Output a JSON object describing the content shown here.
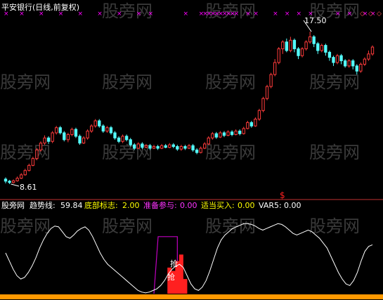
{
  "title": "平安银行(日线,前复权)",
  "watermark": "股旁网",
  "colors": {
    "background": "#000000",
    "up_candle": "#ff3b3b",
    "down_candle": "#54ffff",
    "marker": "#ff00ff",
    "trend_line": "#ffffff",
    "bottom_bar": "#ff2020",
    "prepare_box": "#c000c0",
    "base_band": "#ff9900",
    "label_yellow": "#ffff00",
    "label_magenta": "#ff33ff",
    "label_white": "#ffffff"
  },
  "price_panel": {
    "high_label": "17.50",
    "low_label": "8.61",
    "low_marker": "8.61"
  },
  "indicator_panel": {
    "name": "股旁网",
    "items": [
      {
        "label": "趋势线:",
        "value": "59.84"
      },
      {
        "label": "底部标志:",
        "value": "2.00"
      },
      {
        "label": "准备参与:",
        "value": "0.00"
      },
      {
        "label": "适当买入:",
        "value": "0.00"
      },
      {
        "label": "VAR5:",
        "value": "0.00"
      }
    ],
    "signal_text": "抢",
    "signal_text_2": "抢"
  },
  "chart_data": {
    "type": "candlestick",
    "title": "平安银行(日线,前复权)",
    "price_range": [
      8.61,
      17.5
    ],
    "ylim": [
      8.2,
      18.2
    ],
    "candles": [
      [
        8.9,
        8.78,
        9.0,
        8.65
      ],
      [
        8.78,
        8.7,
        8.85,
        8.61
      ],
      [
        8.7,
        8.8,
        8.88,
        8.64
      ],
      [
        8.8,
        8.95,
        9.05,
        8.75
      ],
      [
        8.95,
        9.15,
        9.25,
        8.9
      ],
      [
        9.15,
        9.4,
        9.5,
        9.1
      ],
      [
        9.4,
        9.7,
        9.8,
        9.35
      ],
      [
        9.7,
        10.1,
        10.2,
        9.65
      ],
      [
        10.1,
        10.6,
        10.7,
        10.0
      ],
      [
        10.6,
        11.0,
        11.1,
        10.5
      ],
      [
        11.0,
        11.3,
        11.45,
        10.9
      ],
      [
        11.3,
        11.1,
        11.4,
        10.95
      ],
      [
        11.1,
        11.6,
        11.7,
        11.0
      ],
      [
        11.6,
        11.9,
        12.0,
        11.5
      ],
      [
        11.9,
        11.6,
        12.0,
        11.5
      ],
      [
        11.6,
        11.2,
        11.7,
        11.1
      ],
      [
        11.2,
        11.5,
        11.6,
        11.05
      ],
      [
        11.5,
        11.8,
        11.9,
        11.4
      ],
      [
        11.8,
        11.4,
        11.9,
        11.3
      ],
      [
        11.4,
        11.0,
        11.5,
        10.9
      ],
      [
        11.0,
        11.3,
        11.4,
        10.95
      ],
      [
        11.3,
        11.7,
        11.8,
        11.2
      ],
      [
        11.7,
        12.0,
        12.1,
        11.6
      ],
      [
        12.0,
        12.3,
        12.4,
        11.9
      ],
      [
        12.3,
        12.0,
        12.4,
        11.9
      ],
      [
        12.0,
        11.7,
        12.1,
        11.6
      ],
      [
        11.7,
        11.9,
        12.0,
        11.6
      ],
      [
        11.9,
        11.6,
        12.0,
        11.5
      ],
      [
        11.6,
        11.3,
        11.7,
        11.2
      ],
      [
        11.3,
        11.1,
        11.4,
        11.0
      ],
      [
        11.1,
        11.4,
        11.5,
        11.0
      ],
      [
        11.4,
        11.2,
        11.5,
        11.1
      ],
      [
        11.2,
        10.9,
        11.3,
        10.8
      ],
      [
        10.9,
        10.7,
        11.0,
        10.6
      ],
      [
        10.7,
        10.95,
        11.05,
        10.65
      ],
      [
        10.95,
        10.75,
        11.05,
        10.65
      ],
      [
        10.75,
        10.85,
        10.95,
        10.7
      ],
      [
        10.85,
        10.7,
        10.95,
        10.6
      ],
      [
        10.7,
        10.8,
        10.9,
        10.65
      ],
      [
        10.8,
        10.7,
        10.9,
        10.6
      ],
      [
        10.7,
        10.85,
        10.95,
        10.65
      ],
      [
        10.85,
        10.75,
        10.95,
        10.7
      ],
      [
        10.75,
        10.9,
        11.0,
        10.7
      ],
      [
        10.9,
        10.8,
        11.0,
        10.7
      ],
      [
        10.8,
        10.65,
        10.9,
        10.55
      ],
      [
        10.65,
        10.8,
        10.9,
        10.55
      ],
      [
        10.8,
        10.7,
        10.9,
        10.6
      ],
      [
        10.7,
        10.85,
        10.95,
        10.65
      ],
      [
        10.85,
        10.6,
        10.95,
        10.5
      ],
      [
        10.6,
        10.45,
        10.7,
        10.35
      ],
      [
        10.45,
        10.7,
        10.8,
        10.4
      ],
      [
        10.7,
        10.95,
        11.05,
        10.65
      ],
      [
        10.95,
        11.3,
        11.4,
        10.9
      ],
      [
        11.3,
        11.55,
        11.65,
        11.2
      ],
      [
        11.55,
        11.35,
        11.65,
        11.25
      ],
      [
        11.35,
        11.6,
        11.7,
        11.3
      ],
      [
        11.6,
        11.45,
        11.7,
        11.35
      ],
      [
        11.45,
        11.65,
        11.75,
        11.4
      ],
      [
        11.65,
        11.5,
        11.75,
        11.4
      ],
      [
        11.5,
        11.7,
        11.8,
        11.45
      ],
      [
        11.7,
        11.55,
        11.8,
        11.45
      ],
      [
        11.55,
        11.85,
        11.95,
        11.5
      ],
      [
        11.85,
        12.2,
        12.3,
        11.8
      ],
      [
        12.2,
        12.0,
        12.3,
        11.9
      ],
      [
        12.0,
        12.4,
        12.5,
        11.95
      ],
      [
        12.4,
        12.9,
        13.0,
        12.3
      ],
      [
        12.9,
        13.6,
        13.7,
        12.8
      ],
      [
        13.6,
        14.3,
        14.4,
        13.5
      ],
      [
        14.3,
        15.0,
        15.1,
        14.2
      ],
      [
        15.0,
        15.7,
        15.9,
        14.9
      ],
      [
        15.7,
        16.5,
        16.6,
        15.6
      ],
      [
        16.5,
        16.9,
        17.0,
        16.2
      ],
      [
        16.9,
        16.4,
        17.1,
        16.3
      ],
      [
        16.4,
        17.0,
        17.2,
        16.3
      ],
      [
        17.0,
        16.5,
        17.1,
        16.3
      ],
      [
        16.5,
        16.1,
        16.6,
        15.9
      ],
      [
        16.1,
        16.5,
        16.6,
        16.0
      ],
      [
        16.5,
        16.9,
        17.0,
        16.4
      ],
      [
        16.9,
        17.2,
        17.5,
        16.8
      ],
      [
        17.2,
        16.8,
        17.3,
        16.6
      ],
      [
        16.8,
        16.4,
        16.9,
        16.2
      ],
      [
        16.4,
        16.7,
        16.8,
        16.3
      ],
      [
        16.7,
        16.3,
        16.8,
        16.1
      ],
      [
        16.3,
        16.0,
        16.4,
        15.8
      ],
      [
        16.0,
        15.7,
        16.1,
        15.5
      ],
      [
        15.7,
        16.1,
        16.2,
        15.6
      ],
      [
        16.1,
        15.8,
        16.2,
        15.6
      ],
      [
        15.8,
        15.5,
        15.9,
        15.4
      ],
      [
        15.5,
        15.8,
        15.9,
        15.4
      ],
      [
        15.8,
        15.5,
        15.9,
        15.3
      ],
      [
        15.5,
        15.2,
        15.6,
        15.0
      ],
      [
        15.2,
        15.6,
        15.7,
        15.1
      ],
      [
        15.6,
        15.9,
        16.0,
        15.5
      ],
      [
        15.9,
        16.2,
        16.4,
        15.8
      ],
      [
        16.2,
        16.6,
        16.7,
        16.1
      ]
    ],
    "markers": [
      0,
      4,
      9,
      14,
      19,
      24,
      29,
      34,
      37,
      46,
      50,
      51,
      52,
      53,
      54,
      55,
      56,
      57,
      58,
      59,
      62,
      64,
      69,
      72,
      75,
      78,
      85,
      88,
      92,
      94
    ],
    "indicator": {
      "trend_line": [
        50,
        40,
        30,
        22,
        18,
        20,
        26,
        34,
        44,
        56,
        66,
        74,
        80,
        83,
        82,
        76,
        70,
        68,
        72,
        77,
        80,
        82,
        78,
        70,
        60,
        50,
        42,
        36,
        32,
        28,
        24,
        20,
        16,
        12,
        8,
        4,
        2,
        1,
        2,
        4,
        6,
        10,
        16,
        24,
        30,
        34,
        36,
        32,
        22,
        12,
        6,
        4,
        8,
        16,
        28,
        42,
        56,
        66,
        72,
        76,
        80,
        82,
        84,
        86,
        86,
        85,
        83,
        80,
        78,
        80,
        82,
        84,
        86,
        85,
        82,
        78,
        74,
        72,
        74,
        76,
        78,
        76,
        72,
        68,
        62,
        56,
        46,
        36,
        26,
        18,
        12,
        10,
        16,
        26,
        40,
        52,
        58,
        60
      ],
      "ylim": [
        0,
        100
      ],
      "bottom_bars": [
        [
          42,
          32
        ],
        [
          43,
          28
        ],
        [
          44,
          40
        ],
        [
          45,
          48
        ],
        [
          46,
          18
        ]
      ],
      "prepare_box": {
        "start": 38,
        "end": 44,
        "top": 70
      },
      "buy_signal_index": 44
    }
  }
}
